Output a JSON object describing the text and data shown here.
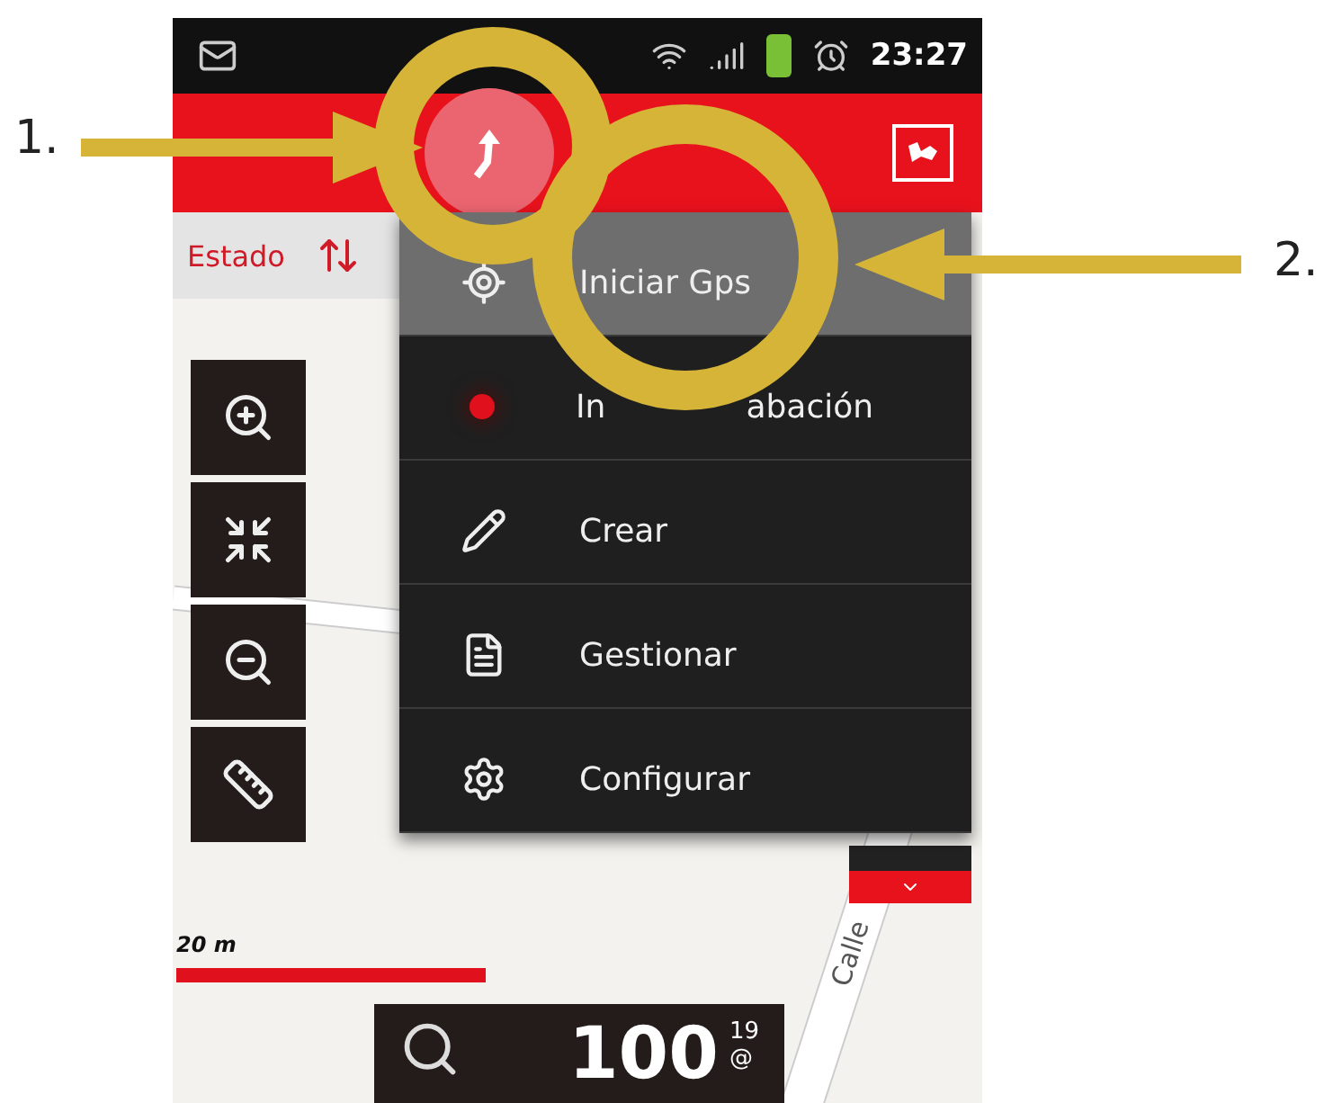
{
  "status_bar": {
    "time": "23:27"
  },
  "app_bar": {
    "route_button_active": true
  },
  "status_strip": {
    "label": "Estado"
  },
  "menu": [
    {
      "kind": "gps",
      "label": "Iniciar Gps",
      "selected": true
    },
    {
      "kind": "record",
      "label_parts": [
        "In",
        "abación"
      ],
      "selected": false
    },
    {
      "kind": "create",
      "label": "Crear",
      "selected": false
    },
    {
      "kind": "manage",
      "label": "Gestionar",
      "selected": false
    },
    {
      "kind": "settings",
      "label": "Configurar",
      "selected": false
    }
  ],
  "zoom_controls": [
    {
      "kind": "zoom-in"
    },
    {
      "kind": "fit"
    },
    {
      "kind": "zoom-out"
    },
    {
      "kind": "measure"
    }
  ],
  "map": {
    "scale": "20 m",
    "street": "Calle"
  },
  "search_panel": {
    "value": "100",
    "superscript": "19",
    "subscript": "@"
  },
  "annotations": [
    {
      "label": "1."
    },
    {
      "label": "2."
    }
  ]
}
